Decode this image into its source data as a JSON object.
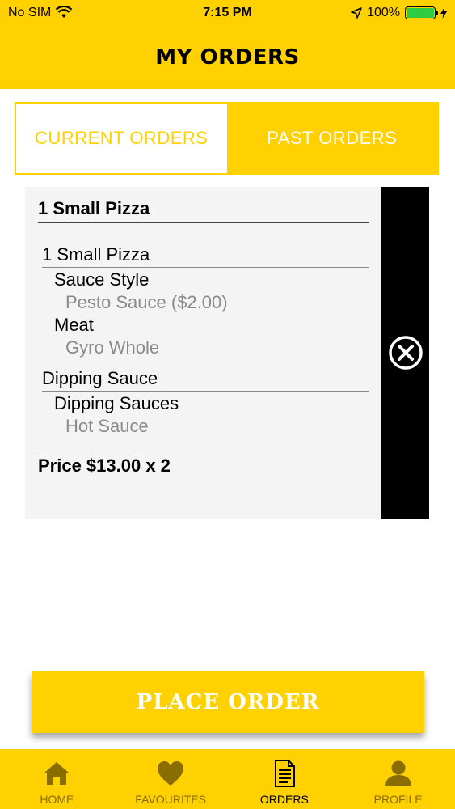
{
  "status_bar": {
    "carrier": "No SIM",
    "time": "7:15 PM",
    "battery": "100%"
  },
  "header": {
    "title": "MY ORDERS"
  },
  "tabs": {
    "current": "CURRENT ORDERS",
    "past": "PAST ORDERS"
  },
  "order": {
    "title": "1 Small Pizza",
    "item": {
      "name": "1 Small Pizza",
      "groups": [
        {
          "name": "Sauce Style",
          "option": "Pesto Sauce ($2.00)"
        },
        {
          "name": "Meat",
          "option": "Gyro Whole"
        }
      ]
    },
    "dipping": {
      "name": "Dipping Sauce",
      "group": "Dipping Sauces",
      "option": "Hot Sauce"
    },
    "price": "Price $13.00 x 2"
  },
  "place_order": {
    "label": "PLACE ORDER"
  },
  "tab_bar": {
    "items": [
      {
        "label": "HOME",
        "icon": "home-icon"
      },
      {
        "label": "FAVOURITES",
        "icon": "heart-icon"
      },
      {
        "label": "ORDERS",
        "icon": "document-icon"
      },
      {
        "label": "PROFILE",
        "icon": "person-icon"
      }
    ],
    "selected": "ORDERS"
  },
  "colors": {
    "accent": "#FFD100",
    "text_muted": "#8a8a8a",
    "delete_bg": "#000000"
  }
}
